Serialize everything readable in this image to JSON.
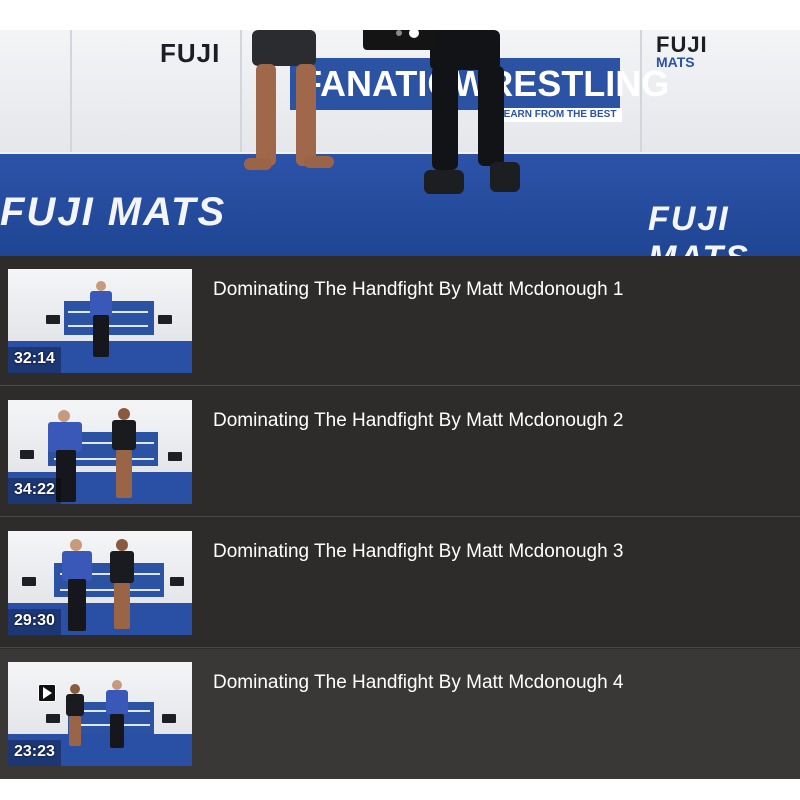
{
  "hero": {
    "banner_left_brand": "FUJI",
    "banner_center_text": "FANATICWRESTLING",
    "banner_sub_text": "LEARN FROM THE BEST",
    "banner_right_brand": "FUJI",
    "banner_right_sub": "MATS",
    "mat_text_left": "FUJI MATS",
    "mat_text_right": "FUJI MATS"
  },
  "playlist": {
    "items": [
      {
        "title": "Dominating The Handfight By Matt Mcdonough 1",
        "duration": "32:14",
        "active": false
      },
      {
        "title": "Dominating The Handfight By Matt Mcdonough 2",
        "duration": "34:22",
        "active": false
      },
      {
        "title": "Dominating The Handfight By Matt Mcdonough 3",
        "duration": "29:30",
        "active": false
      },
      {
        "title": "Dominating The Handfight By Matt Mcdonough 4",
        "duration": "23:23",
        "active": true,
        "icon": "play-icon"
      }
    ]
  },
  "colors": {
    "playlist_bg": "#2e2c2b",
    "active_bg": "#3a3837",
    "mat_blue": "#2a50a6",
    "text": "#ffffff"
  }
}
